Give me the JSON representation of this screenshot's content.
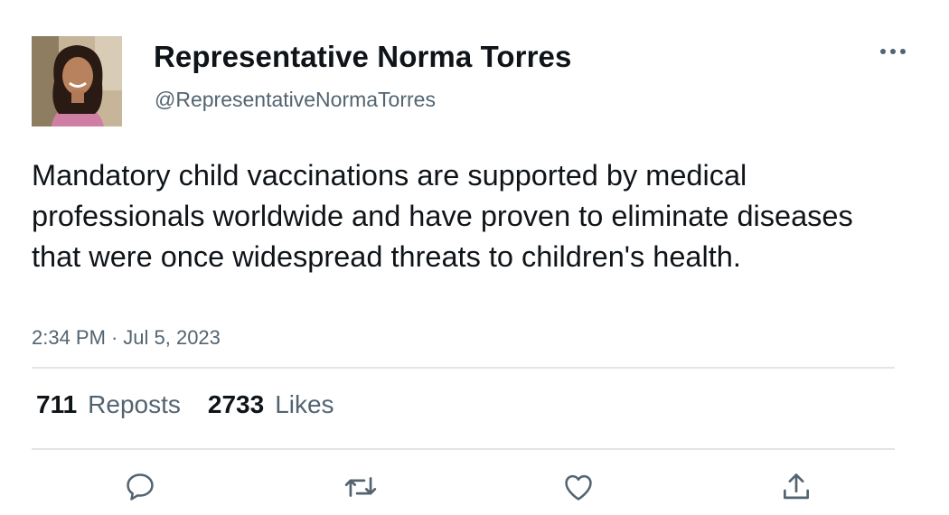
{
  "author": {
    "display_name": "Representative Norma Torres",
    "handle": "@RepresentativeNormaTorres",
    "avatar_icon": "profile-photo"
  },
  "tweet": {
    "text": "Mandatory child vaccinations are supported by medical professionals worldwide and have proven to eliminate diseases that were once widespread threats to children's health.",
    "time": "2:34 PM",
    "separator": "·",
    "date": "Jul 5, 2023"
  },
  "stats": {
    "reposts_count": "711",
    "reposts_label": "Reposts",
    "likes_count": "2733",
    "likes_label": "Likes"
  },
  "actions": {
    "reply_icon": "reply-icon",
    "repost_icon": "repost-icon",
    "like_icon": "heart-icon",
    "share_icon": "share-icon"
  },
  "colors": {
    "text_primary": "#0f1419",
    "text_secondary": "#536471",
    "divider": "#e1e5e8"
  }
}
